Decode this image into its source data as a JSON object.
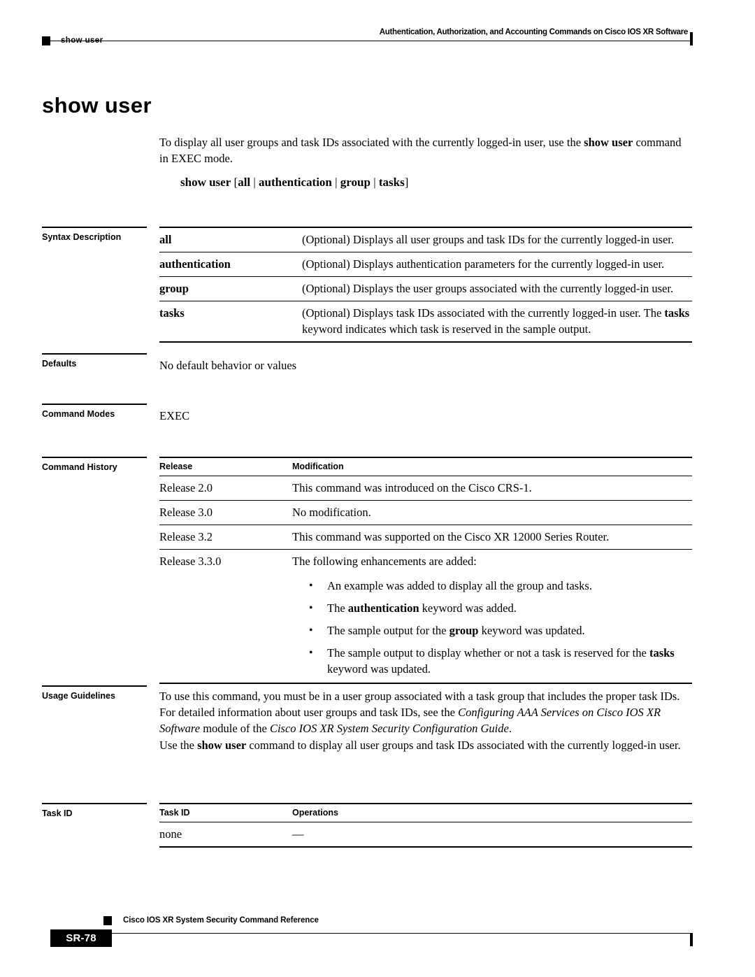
{
  "header": {
    "title": "Authentication, Authorization, and Accounting Commands on Cisco IOS XR Software",
    "breadcrumb": "show user"
  },
  "page_title": "show user",
  "intro": {
    "text_before": "To display all user groups and task IDs associated with the currently logged-in user, use the ",
    "bold_1": "show user",
    "text_after": " command in EXEC mode."
  },
  "syntax": {
    "command": "show user",
    "bracket_open": "[",
    "opt_1": "all",
    "sep_1": "|",
    "opt_2": "authentication",
    "sep_2": "|",
    "opt_3": "group",
    "sep_3": "|",
    "opt_4": "tasks",
    "bracket_close": "]"
  },
  "sections": {
    "syntax_description": "Syntax Description",
    "defaults": "Defaults",
    "command_modes": "Command Modes",
    "command_history": "Command History",
    "usage_guidelines": "Usage Guidelines",
    "task_id": "Task ID"
  },
  "syntax_description_rows": [
    {
      "term": "all",
      "desc": "(Optional) Displays all user groups and task IDs for the currently logged-in user."
    },
    {
      "term": "authentication",
      "desc": "(Optional) Displays authentication parameters for the currently logged-in user."
    },
    {
      "term": "group",
      "desc": "(Optional) Displays the user groups associated with the currently logged-in user."
    },
    {
      "term": "tasks",
      "desc_part_1": "(Optional) Displays task IDs associated with the currently logged-in user. The ",
      "desc_bold": "tasks",
      "desc_part_2": " keyword indicates which task is reserved in the sample output."
    }
  ],
  "defaults_value": "No default behavior or values",
  "command_modes_value": "EXEC",
  "command_history": {
    "col_release": "Release",
    "col_modification": "Modification",
    "rows": [
      {
        "release": "Release 2.0",
        "modification": "This command was introduced on the Cisco CRS-1."
      },
      {
        "release": "Release 3.0",
        "modification": "No modification."
      },
      {
        "release": "Release 3.2",
        "modification": "This command was supported on the Cisco XR 12000 Series Router."
      },
      {
        "release": "Release 3.3.0",
        "modification": "The following enhancements are added:"
      }
    ],
    "bullets": [
      {
        "text_1": "An example was added to display all the group and tasks.",
        "bold": "",
        "text_2": ""
      },
      {
        "text_1": "The ",
        "bold": "authentication",
        "text_2": " keyword was added."
      },
      {
        "text_1": "The sample output for the ",
        "bold": "group",
        "text_2": " keyword was updated."
      },
      {
        "text_1": "The sample output to display whether or not a task is reserved for the ",
        "bold": "tasks",
        "text_2": " keyword was updated."
      }
    ]
  },
  "usage_guidelines": {
    "p1_part1": "To use this command, you must be in a user group associated with a task group that includes the proper task IDs. For detailed information about user groups and task IDs, see the ",
    "p1_italic1": "Configuring AAA Services on Cisco IOS XR Software",
    "p1_part2": " module of the ",
    "p1_italic2": "Cisco IOS XR System Security Configuration Guide",
    "p1_part3": ".",
    "p2_part1": "Use the ",
    "p2_bold": "show user",
    "p2_part2": " command to display all user groups and task IDs associated with the currently logged-in user."
  },
  "task_id_table": {
    "col_task_id": "Task ID",
    "col_operations": "Operations",
    "rows": [
      {
        "task_id": "none",
        "operations": "—"
      }
    ]
  },
  "footer": {
    "book_title": "Cisco IOS XR System Security Command Reference",
    "page_number": "SR-78"
  }
}
